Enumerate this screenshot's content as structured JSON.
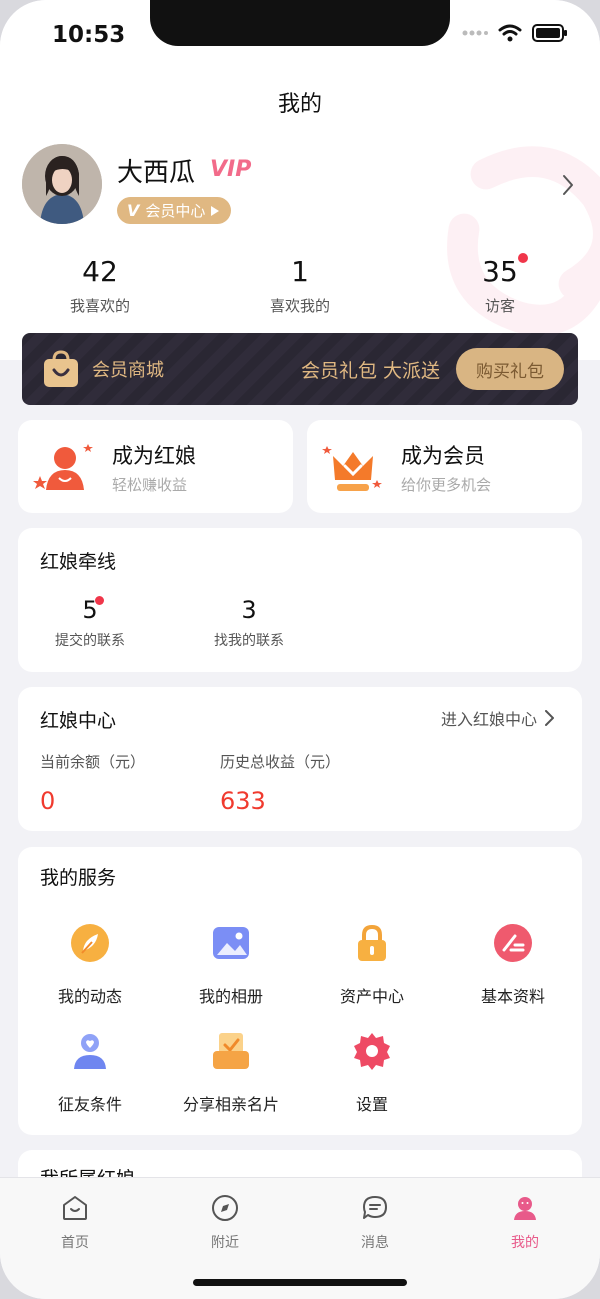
{
  "status_bar": {
    "time": "10:53"
  },
  "header": {
    "title": "我的"
  },
  "profile": {
    "username": "大西瓜",
    "vip_mark": "VIP",
    "vip_pill_v": "V",
    "vip_pill_label": "会员中心"
  },
  "stats": [
    {
      "value": "42",
      "label": "我喜欢的"
    },
    {
      "value": "1",
      "label": "喜欢我的"
    },
    {
      "value": "35",
      "label": "访客"
    }
  ],
  "member_banner": {
    "mall_label": "会员商城",
    "gift_text": "会员礼包 大派送",
    "buy_button": "购买礼包"
  },
  "promo_cards": [
    {
      "title": "成为红娘",
      "subtitle": "轻松赚收益"
    },
    {
      "title": "成为会员",
      "subtitle": "给你更多机会"
    }
  ],
  "matchmaking": {
    "title": "红娘牵线",
    "items": [
      {
        "value": "5",
        "label": "提交的联系"
      },
      {
        "value": "3",
        "label": "找我的联系"
      }
    ]
  },
  "matchmaker_center": {
    "title": "红娘中心",
    "enter_link": "进入红娘中心",
    "balance_label": "当前余额（元）",
    "balance_value": "0",
    "income_label": "历史总收益（元）",
    "income_value": "633"
  },
  "services": {
    "title": "我的服务",
    "items": [
      {
        "label": "我的动态",
        "icon": "feather-icon"
      },
      {
        "label": "我的相册",
        "icon": "photo-album-icon"
      },
      {
        "label": "资产中心",
        "icon": "lock-icon"
      },
      {
        "label": "基本资料",
        "icon": "edit-icon"
      },
      {
        "label": "征友条件",
        "icon": "heart-person-icon"
      },
      {
        "label": "分享相亲名片",
        "icon": "share-card-icon"
      },
      {
        "label": "设置",
        "icon": "gear-icon"
      }
    ]
  },
  "my_matchmaker": {
    "title": "我所属红娘"
  },
  "tabbar": {
    "items": [
      {
        "label": "首页",
        "icon": "home-icon"
      },
      {
        "label": "附近",
        "icon": "compass-icon"
      },
      {
        "label": "消息",
        "icon": "message-icon"
      },
      {
        "label": "我的",
        "icon": "profile-icon"
      }
    ],
    "active": "我的"
  },
  "colors": {
    "accent_pink": "#e85a8a",
    "gold": "#e0b882",
    "money_red": "#f03a2e",
    "badge_red": "#f0364a",
    "banner_dark": "#2a2733"
  }
}
